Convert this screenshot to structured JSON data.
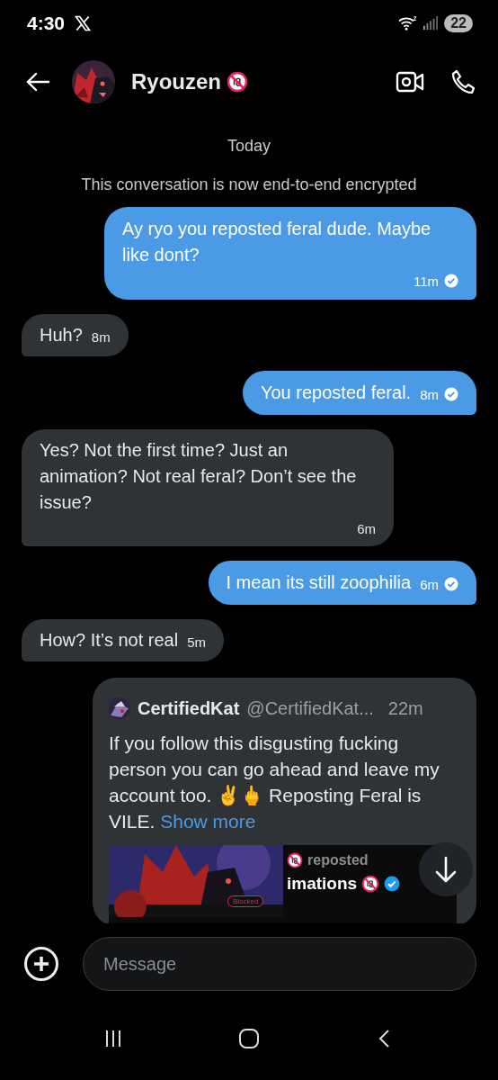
{
  "status_bar": {
    "time": "4:30",
    "battery": "22"
  },
  "header": {
    "name": "Ryouzen",
    "adult_badge": true
  },
  "messages": [
    {
      "kind": "date",
      "text": "Today"
    },
    {
      "kind": "notice",
      "text": "This conversation is now end-to-end encrypted"
    },
    {
      "kind": "sent",
      "text": "Ay ryo you reposted feral dude. Maybe like dont?",
      "time": "11m",
      "read": true
    },
    {
      "kind": "received",
      "text": "Huh?",
      "time": "8m"
    },
    {
      "kind": "sent",
      "text": "You reposted feral.",
      "time": "8m",
      "read": true
    },
    {
      "kind": "received",
      "text": "Yes? Not the first time? Just an animation? Not real feral? Don’t see the issue?",
      "time": "6m"
    },
    {
      "kind": "sent",
      "text": "I mean its still zoophilia",
      "time": "6m",
      "read": true
    },
    {
      "kind": "received",
      "text": "How? It’s not real",
      "time": "5m"
    },
    {
      "kind": "quote",
      "author": "CertifiedKat",
      "handle": "@CertifiedKat...",
      "time": "22m",
      "body": "If you follow this disgusting fucking person you can go ahead and leave my account too. ✌🖕 Reposting Feral is VILE.",
      "more": "Show more",
      "shot": {
        "label": "Blocked",
        "reposted": "reposted",
        "title": "imations"
      }
    }
  ],
  "composer": {
    "placeholder": "Message"
  }
}
